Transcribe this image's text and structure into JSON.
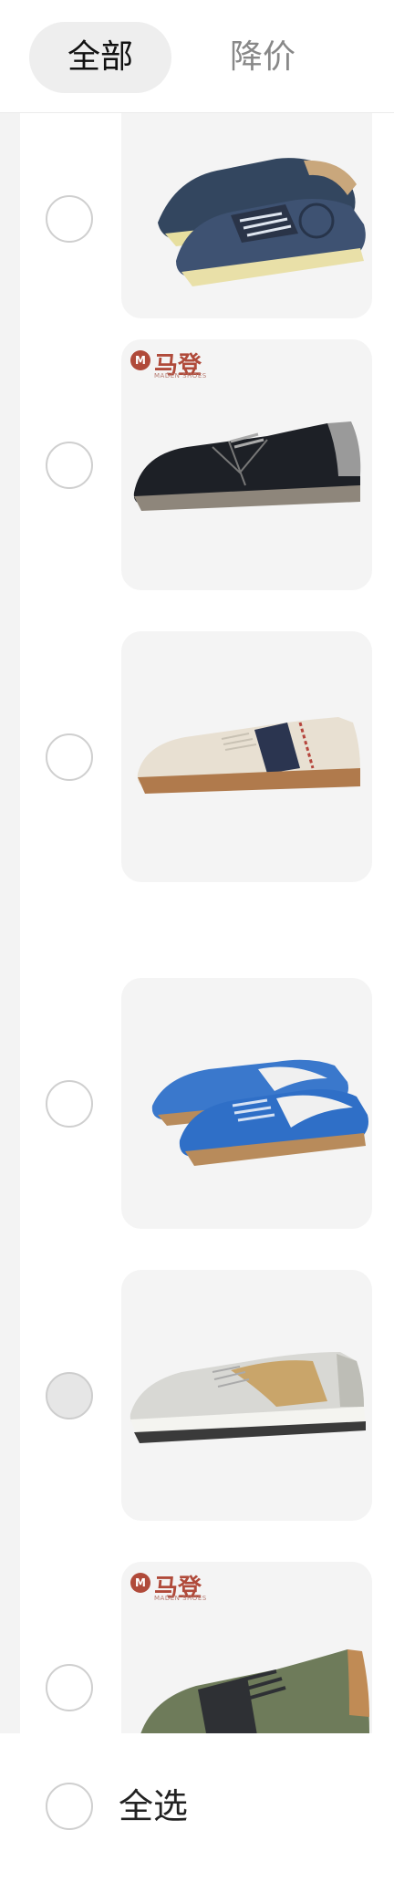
{
  "tabs": {
    "all": "全部",
    "price_drop": "降价"
  },
  "brand": {
    "name": "马登",
    "sub": "MADEN SHOES",
    "mark": "M"
  },
  "items": [
    {
      "state": "unchecked",
      "color": "#3e5272",
      "accent": "#c9a77c",
      "sole": "#e9e0a8",
      "branded": false
    },
    {
      "state": "unchecked",
      "color": "#1d2026",
      "accent": "#9a9a9a",
      "sole": "#8e867b",
      "branded": true
    },
    {
      "state": "unchecked",
      "color": "#e8e0d2",
      "accent": "#2b3550",
      "sole": "#b07a4c",
      "branded": false
    },
    {
      "state": "unchecked",
      "color": "#2f6fc7",
      "accent": "#f0f0f0",
      "sole": "#b88b5b",
      "branded": false
    },
    {
      "state": "filled",
      "color": "#d8d8d4",
      "accent": "#c9a56a",
      "sole": "#3a3a3a",
      "branded": false
    },
    {
      "state": "unchecked",
      "color": "#6e7b5a",
      "accent": "#2e3034",
      "sole": "#c08b55",
      "branded": true
    }
  ],
  "footer": {
    "select_all": "全选"
  }
}
